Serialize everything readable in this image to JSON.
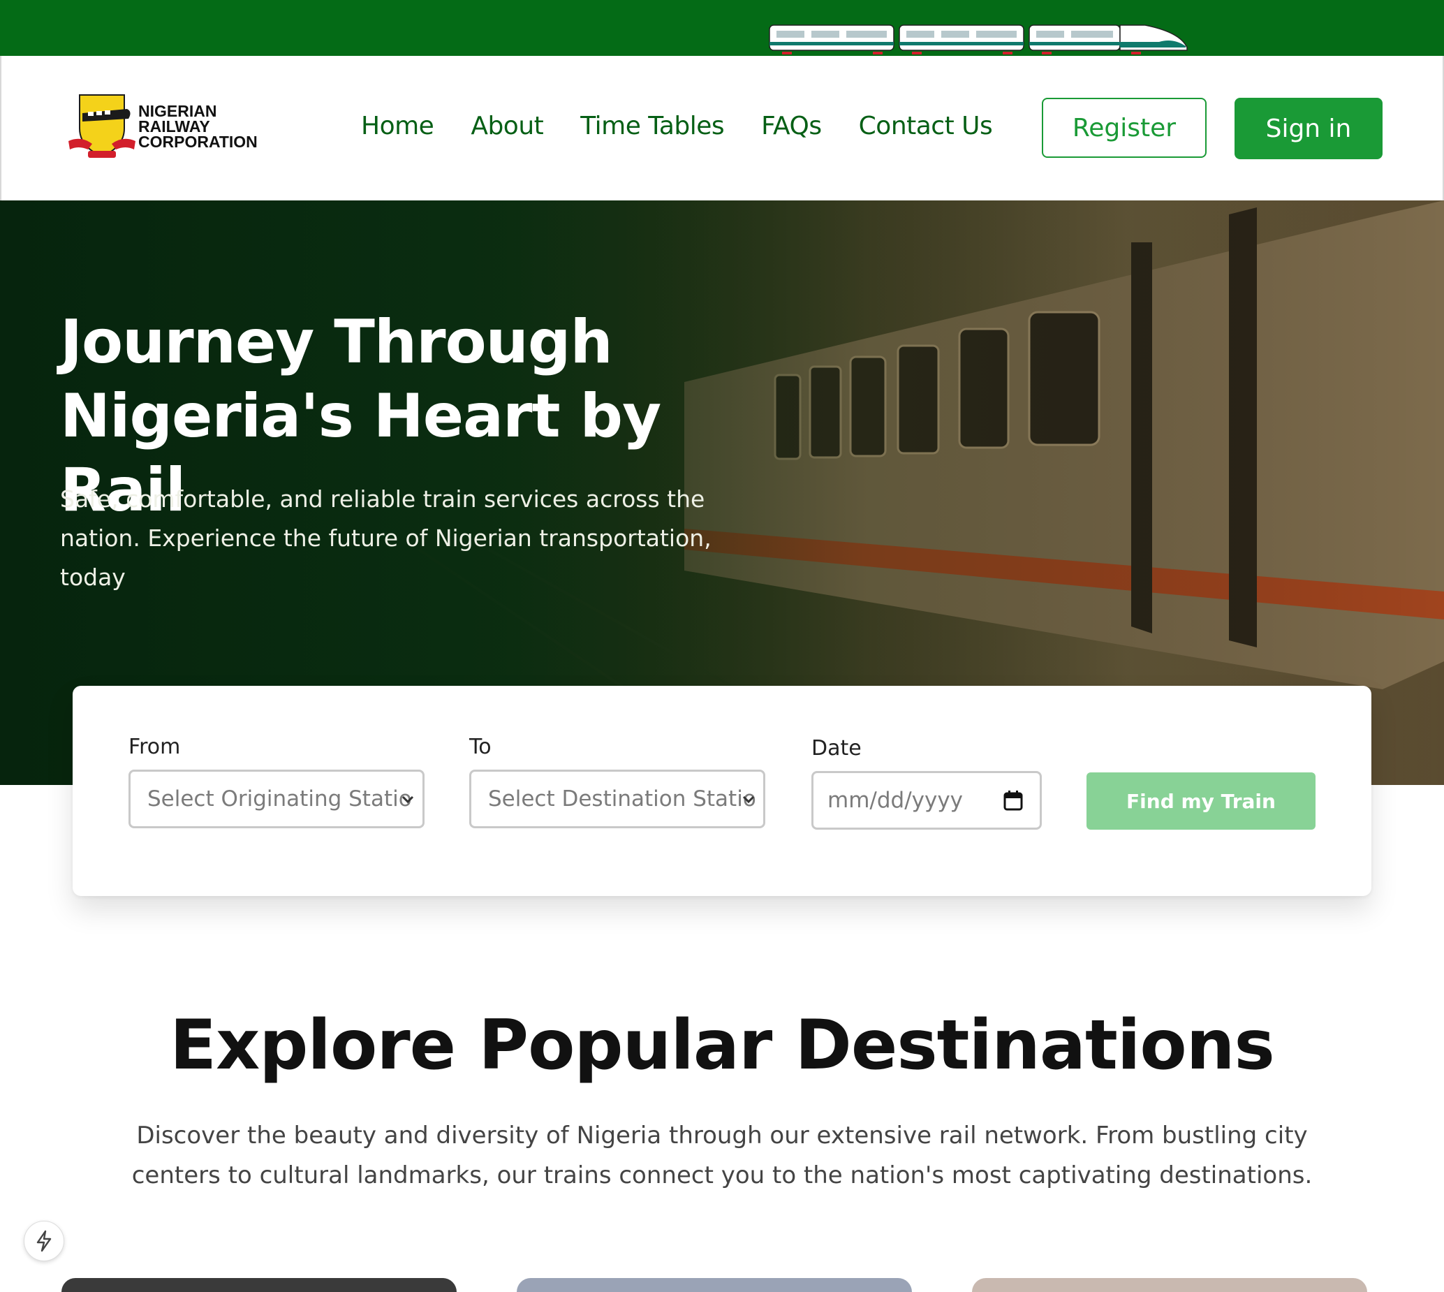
{
  "brand": {
    "name_lines": [
      "NIGERIAN",
      "RAILWAY",
      "CORPORATION"
    ],
    "primary_color": "#1a9a36",
    "dark_green": "#046b16"
  },
  "nav": {
    "items": [
      "Home",
      "About",
      "Time Tables",
      "FAQs",
      "Contact Us"
    ],
    "register_label": "Register",
    "signin_label": "Sign in"
  },
  "hero": {
    "title": "Journey Through Nigeria's Heart by Rail",
    "subtitle": "Safe, comfortable, and reliable train services across the nation. Experience the future of Nigerian transportation, today"
  },
  "search": {
    "from_label": "From",
    "from_placeholder": "Select Originating Statio",
    "to_label": "To",
    "to_placeholder": "Select Destination Statio",
    "date_label": "Date",
    "date_placeholder": "mm/dd/yyyy",
    "find_label": "Find my Train"
  },
  "explore": {
    "title": "Explore Popular Destinations",
    "description": "Discover the beauty and diversity of Nigeria through our extensive rail network. From bustling city centers to cultural landmarks, our trains connect you to the nation's most captivating destinations."
  },
  "icons": {
    "train_banner": "train-icon",
    "calendar": "calendar-icon",
    "chevron": "chevron-down-icon",
    "fab": "bolt-icon"
  }
}
